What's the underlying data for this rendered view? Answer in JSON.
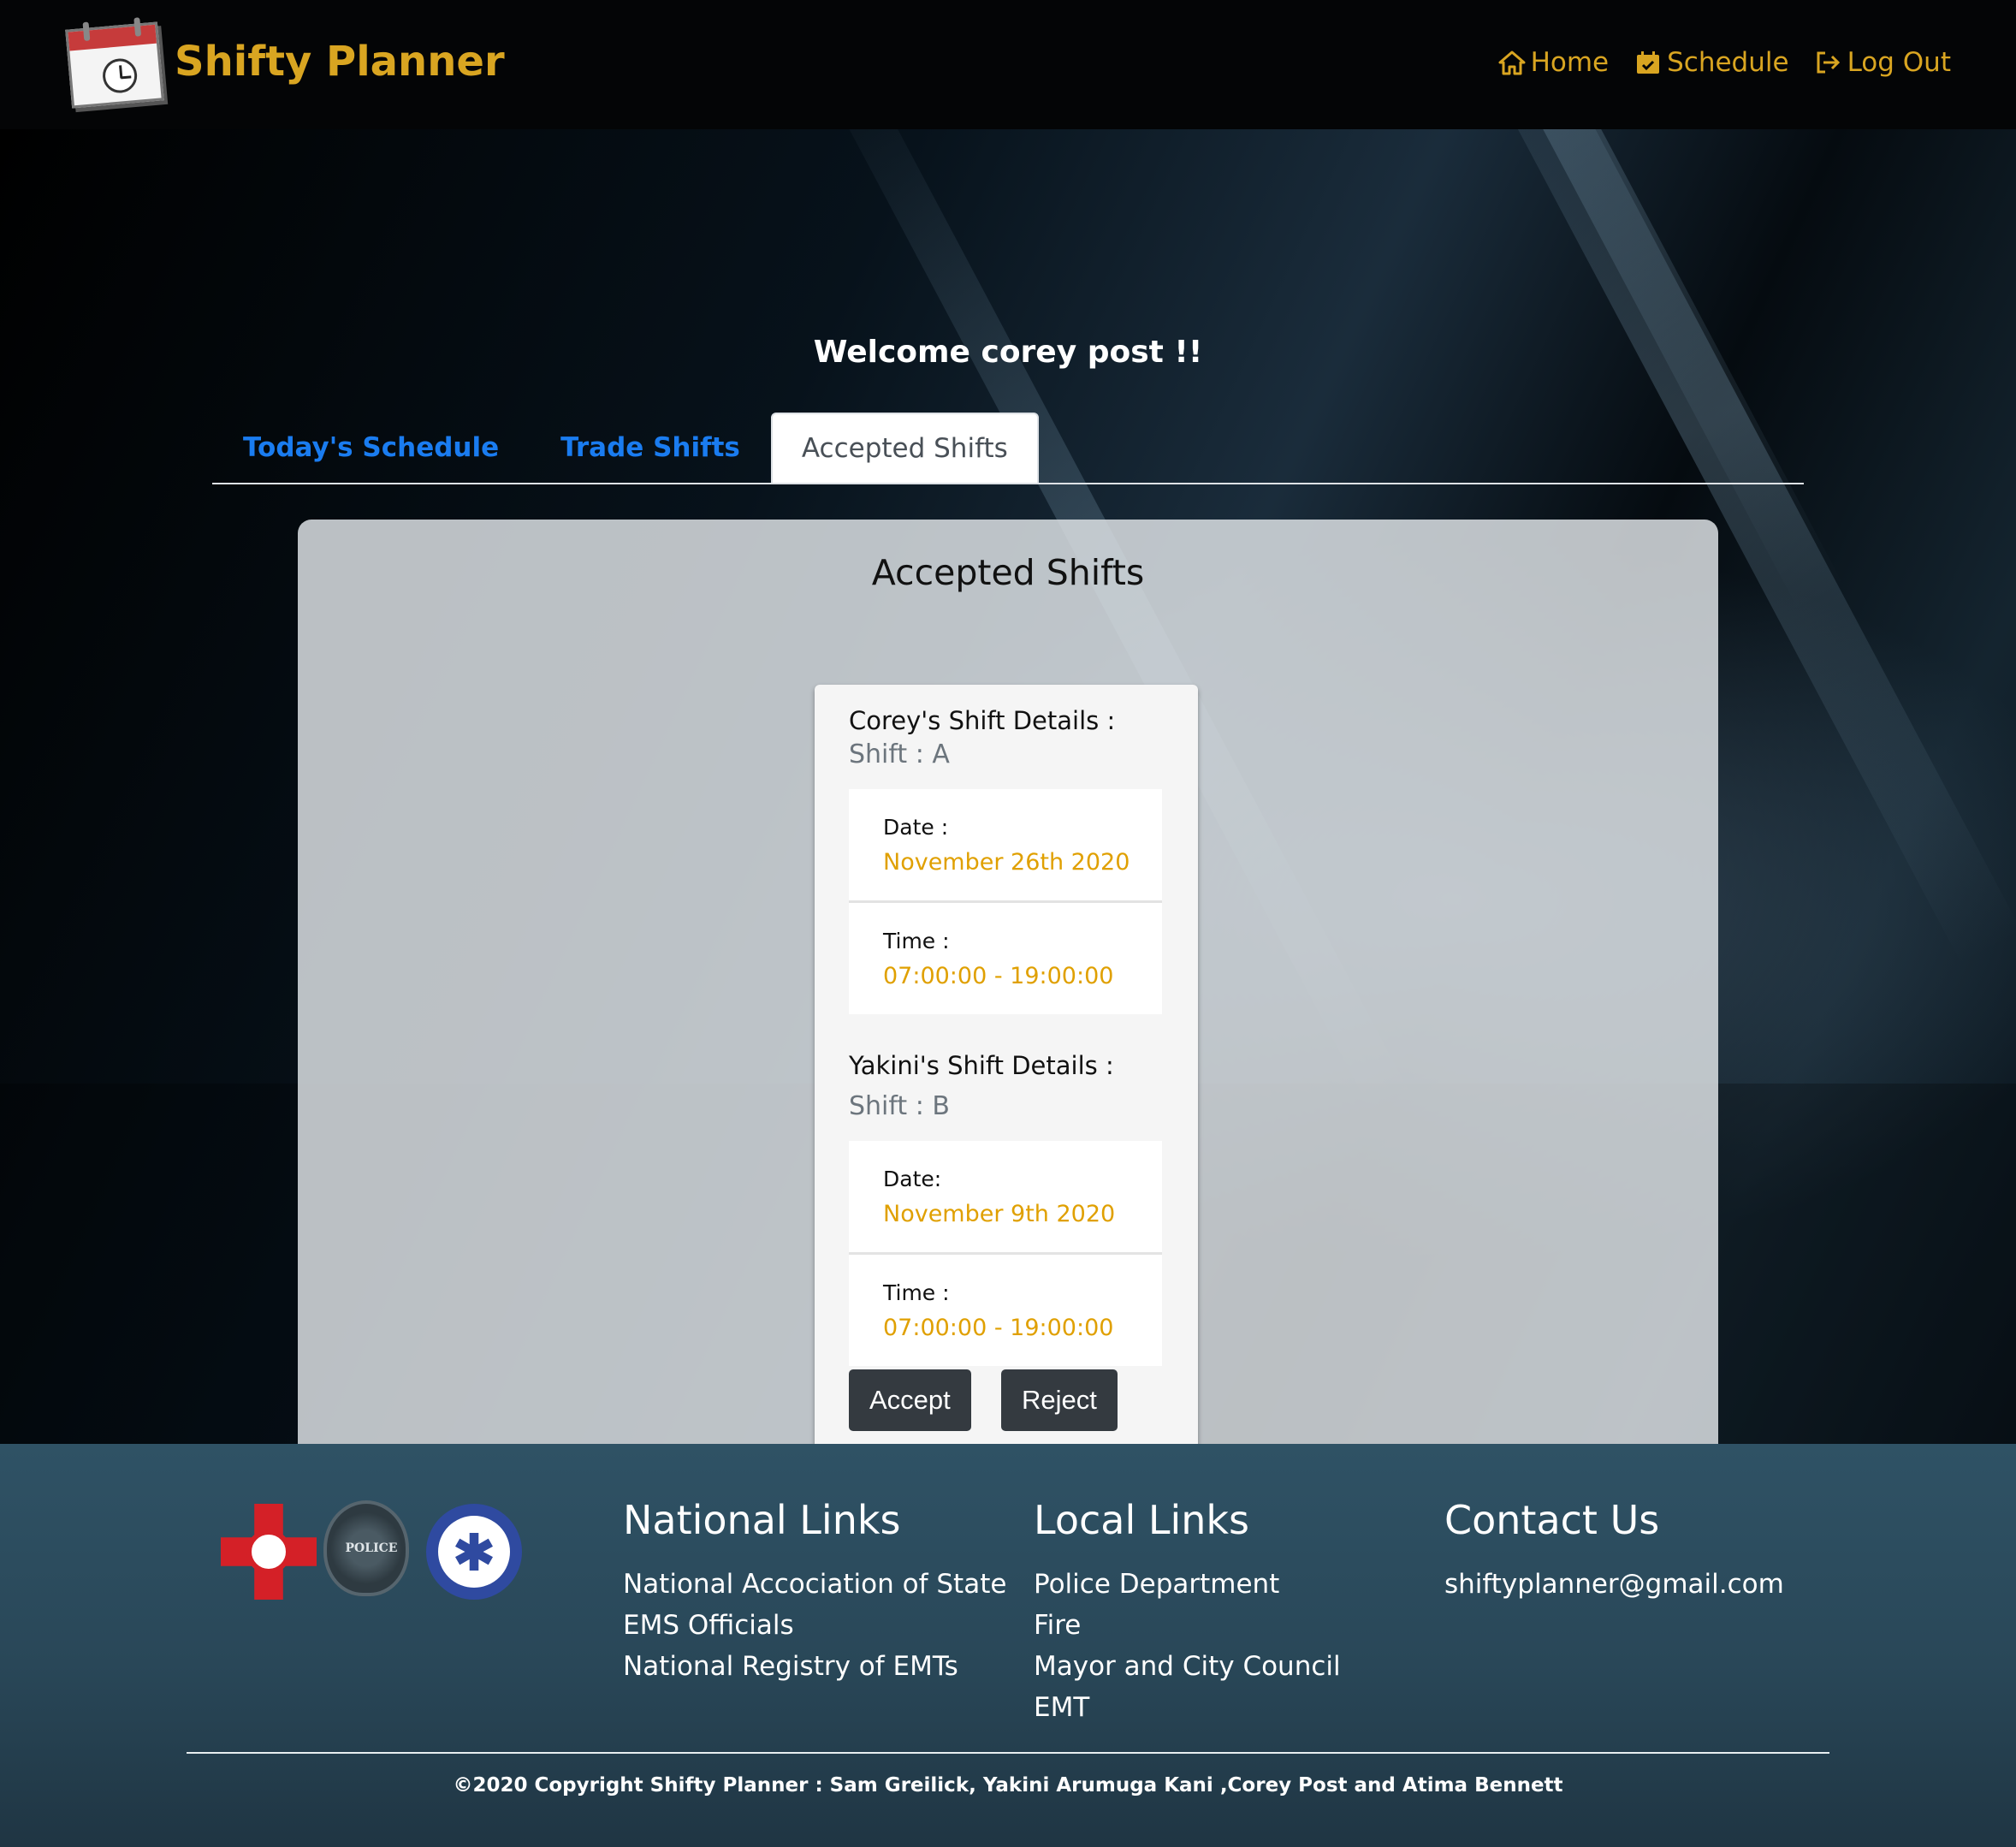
{
  "brand": {
    "name": "Shifty Planner",
    "logo_text": "SHIFTY PLANNER"
  },
  "nav": {
    "home_label": "Home",
    "schedule_label": "Schedule",
    "logout_label": "Log Out"
  },
  "welcome_text": "Welcome corey post !!",
  "tabs": [
    {
      "label": "Today's Schedule",
      "active": false
    },
    {
      "label": "Trade Shifts",
      "active": false
    },
    {
      "label": "Accepted Shifts",
      "active": true
    }
  ],
  "panel": {
    "title": "Accepted Shifts",
    "card": {
      "first": {
        "title": "Corey's Shift Details :",
        "shift": "Shift : A",
        "date_label": "Date :",
        "date_value": "November 26th 2020",
        "time_label": "Time :",
        "time_value": "07:00:00 - 19:00:00"
      },
      "second": {
        "title": "Yakini's Shift Details :",
        "shift": "Shift : B",
        "date_label": "Date:",
        "date_value": "November 9th 2020",
        "time_label": "Time :",
        "time_value": "07:00:00 - 19:00:00"
      },
      "accept_label": "Accept",
      "reject_label": "Reject"
    }
  },
  "footer": {
    "badges": {
      "fire_text": "FIRE DEPT",
      "police_text": "POLICE",
      "ems_text": "EMERGENCY MEDICAL SERVICES"
    },
    "national": {
      "title": "National Links",
      "links": [
        "National Accociation of State EMS Officials",
        "National Registry of EMTs"
      ]
    },
    "local": {
      "title": "Local Links",
      "links": [
        "Police Department",
        "Fire",
        "Mayor and City Council",
        "EMT"
      ]
    },
    "contact": {
      "title": "Contact Us",
      "email": "shiftyplanner@gmail.com"
    },
    "copyright": "©2020 Copyright Shifty Planner : Sam Greilick, Yakini Arumuga Kani ,Corey Post and Atima Bennett"
  },
  "colors": {
    "accent": "#d9a521",
    "tab_link": "#1a7cf0",
    "value_text": "#e0a000",
    "button_bg": "#343a40"
  }
}
